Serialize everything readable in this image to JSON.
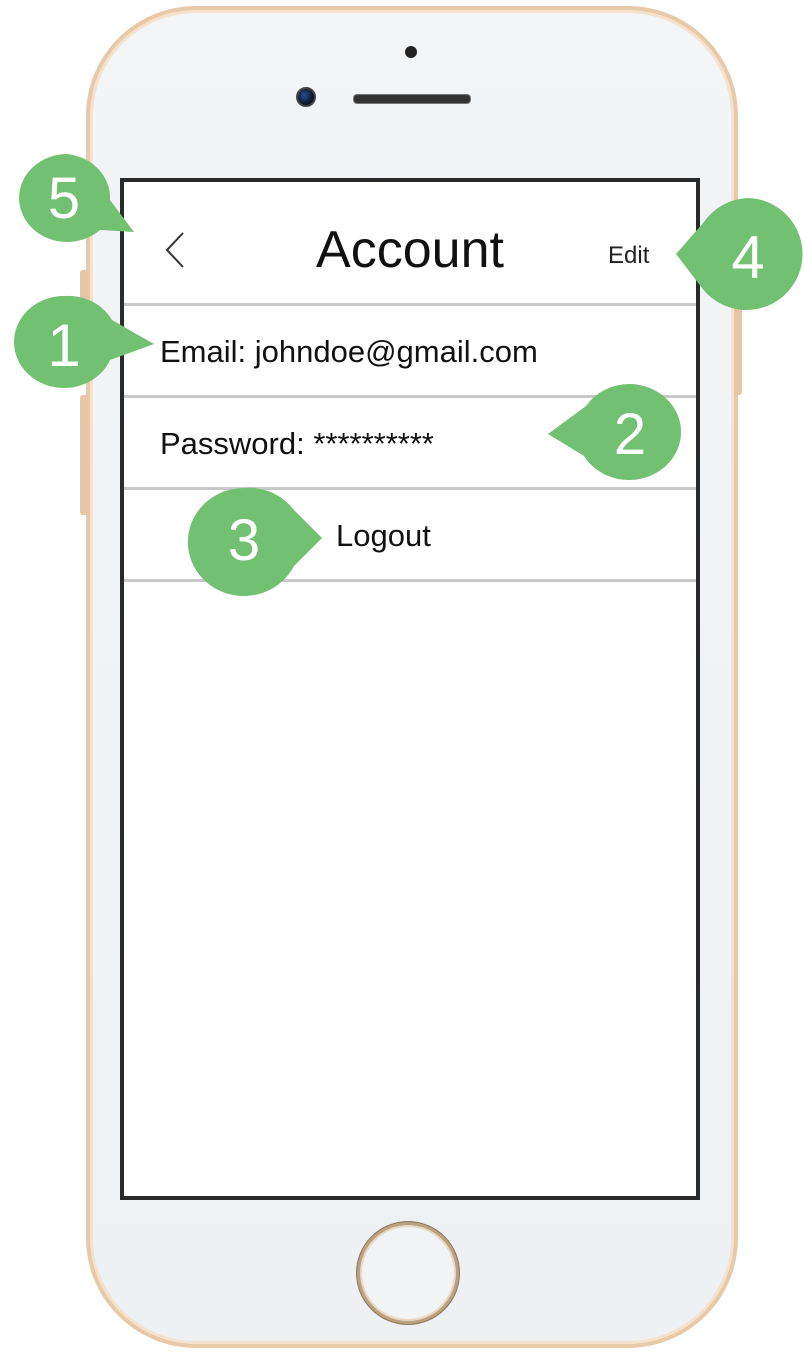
{
  "header": {
    "title": "Account",
    "back_icon": "chevron-left-icon",
    "edit_label": "Edit"
  },
  "rows": [
    {
      "label": "Email: johndoe@gmail.com"
    },
    {
      "label": "Password: **********"
    },
    {
      "label": "Logout"
    }
  ],
  "callouts": [
    "1",
    "2",
    "3",
    "4",
    "5"
  ],
  "colors": {
    "callout": "#72c172",
    "frame": "#e8c9a8",
    "divider": "#c8c8c8",
    "screen_border": "#2a2a2a"
  }
}
